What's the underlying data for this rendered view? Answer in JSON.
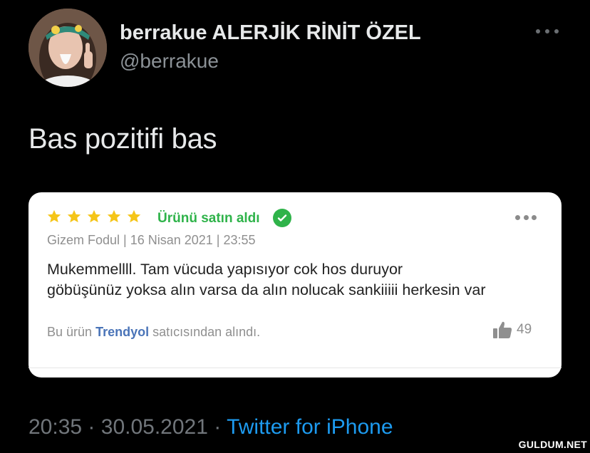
{
  "tweet": {
    "display_name": "berrakue ALERJİK RİNİT ÖZEL",
    "handle": "@berrakue",
    "text": "Bas pozitifi bas",
    "time": "20:35",
    "separator": "·",
    "date": "30.05.2021",
    "source": "Twitter for iPhone",
    "more_icon": "more-horizontal-icon"
  },
  "review_card": {
    "rating": 5,
    "rating_max": 5,
    "star_color": "#f5c518",
    "badge_text": "Ürünü satın aldı",
    "badge_color": "#2fb34a",
    "meta": "Gizem Fodul | 16 Nisan 2021 | 23:55",
    "review_lines": [
      "Mukemmellll. Tam vücuda yapısıyor cok hos duruyor",
      "göbüşünüz yoksa alın varsa da alın nolucak sankiiiii herkesin var"
    ],
    "source_prefix": "Bu ürün",
    "seller": "Trendyol",
    "source_suffix": "satıcısından alındı.",
    "likes": "49"
  },
  "watermark": "GULDUM.NET"
}
